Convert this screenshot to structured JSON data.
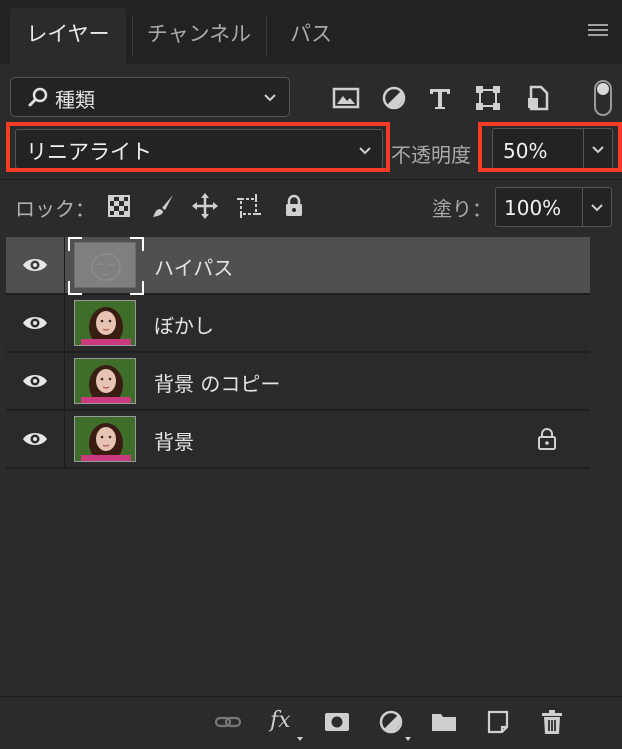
{
  "tabs": [
    {
      "label": "レイヤー",
      "active": true
    },
    {
      "label": "チャンネル",
      "active": false
    },
    {
      "label": "パス",
      "active": false
    }
  ],
  "filter": {
    "label": "種類"
  },
  "blend_mode": {
    "value": "リニアライト"
  },
  "opacity": {
    "label": "不透明度",
    "value": "50%"
  },
  "lock": {
    "label": "ロック："
  },
  "fill": {
    "label": "塗り：",
    "value": "100%"
  },
  "layers": [
    {
      "name": "ハイパス",
      "thumb": "highpass",
      "selected": true,
      "locked": false
    },
    {
      "name": "ぼかし",
      "thumb": "photo",
      "selected": false,
      "locked": false
    },
    {
      "name": "背景 のコピー",
      "thumb": "photo",
      "selected": false,
      "locked": false
    },
    {
      "name": "背景",
      "thumb": "photo",
      "selected": false,
      "locked": true
    }
  ],
  "bottom": {
    "fx_label": "fx"
  },
  "colors": {
    "highlight": "#f33b25",
    "selected_row": "#505050",
    "panel_bg": "#2b2b2b"
  }
}
